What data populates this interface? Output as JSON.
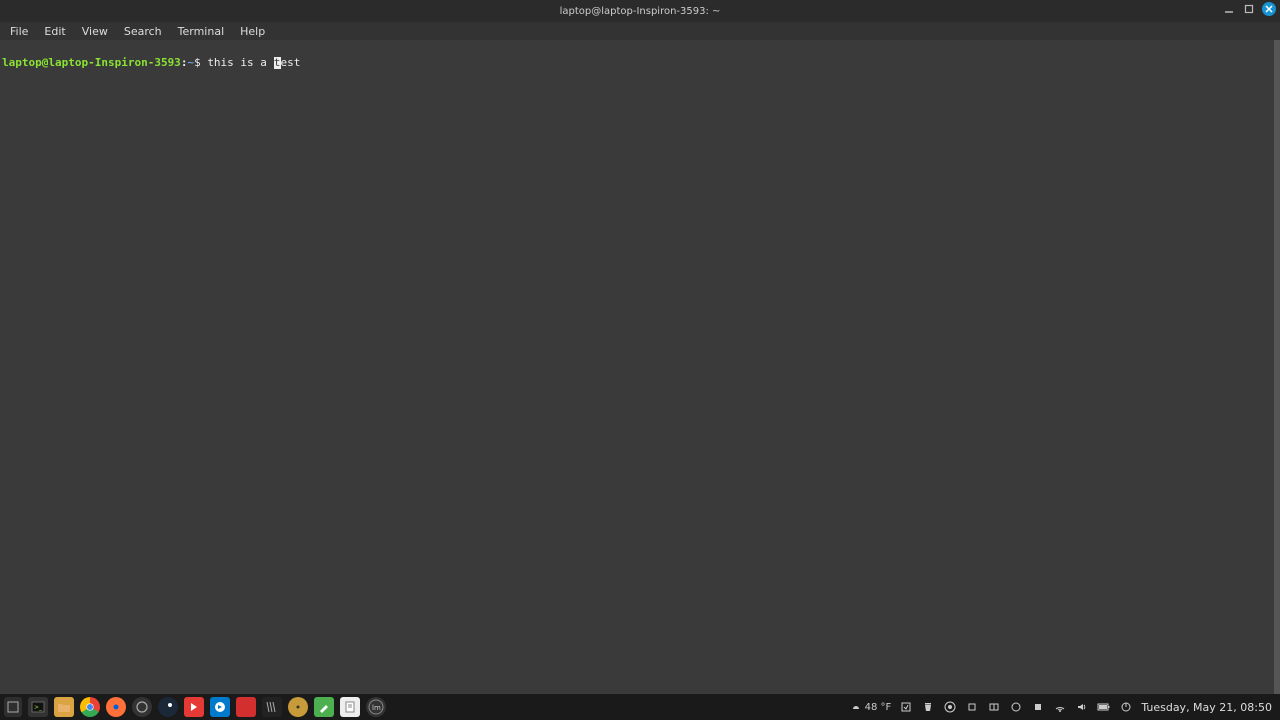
{
  "titlebar": {
    "title": "laptop@laptop-Inspiron-3593: ~"
  },
  "menu": {
    "file": "File",
    "edit": "Edit",
    "view": "View",
    "search": "Search",
    "terminal": "Terminal",
    "help": "Help"
  },
  "prompt": {
    "user_host": "laptop@laptop-Inspiron-3593",
    "sep": ":",
    "path": "~",
    "symbol": "$",
    "cmd_before": "this is a ",
    "cursor_char": "t",
    "cmd_after": "est"
  },
  "tray": {
    "temp": "48 °F",
    "clock": "Tuesday, May 21, 08:50"
  }
}
